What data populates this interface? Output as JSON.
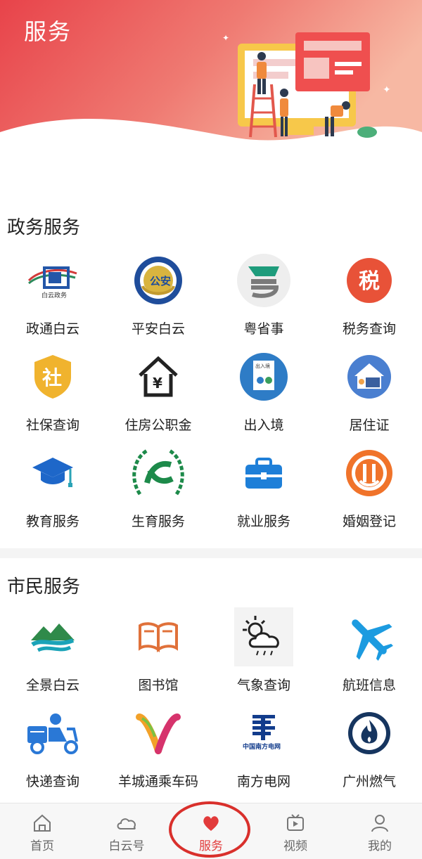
{
  "header": {
    "title": "服务"
  },
  "sections": [
    {
      "title": "政务服务",
      "items": [
        {
          "label": "政通白云",
          "icon": "baiyun-gov-icon"
        },
        {
          "label": "平安白云",
          "icon": "police-badge-icon"
        },
        {
          "label": "粤省事",
          "icon": "yueshengshi-icon"
        },
        {
          "label": "税务查询",
          "icon": "tax-icon"
        },
        {
          "label": "社保查询",
          "icon": "social-security-icon"
        },
        {
          "label": "住房公职金",
          "icon": "housing-fund-icon"
        },
        {
          "label": "出入境",
          "icon": "immigration-icon"
        },
        {
          "label": "居住证",
          "icon": "residence-permit-icon"
        },
        {
          "label": "教育服务",
          "icon": "graduation-cap-icon"
        },
        {
          "label": "生育服务",
          "icon": "birth-service-icon"
        },
        {
          "label": "就业服务",
          "icon": "briefcase-icon"
        },
        {
          "label": "婚姻登记",
          "icon": "marriage-registration-icon"
        }
      ]
    },
    {
      "title": "市民服务",
      "items": [
        {
          "label": "全景白云",
          "icon": "mountain-panorama-icon"
        },
        {
          "label": "图书馆",
          "icon": "book-icon"
        },
        {
          "label": "气象查询",
          "icon": "weather-icon"
        },
        {
          "label": "航班信息",
          "icon": "airplane-icon"
        },
        {
          "label": "快递查询",
          "icon": "delivery-scooter-icon"
        },
        {
          "label": "羊城通乘车码",
          "icon": "yangchengtong-icon"
        },
        {
          "label": "南方电网",
          "icon": "power-grid-icon"
        },
        {
          "label": "广州燃气",
          "icon": "gas-flame-icon"
        }
      ]
    }
  ],
  "icon_text": {
    "baiyun_gov": "白云政务",
    "police": "公安",
    "tax": "税",
    "social": "社",
    "housing": "¥",
    "immigration": "出入境",
    "grid_cn": "中国南方电网"
  },
  "tabs": [
    {
      "label": "首页",
      "icon": "home-icon",
      "active": false
    },
    {
      "label": "白云号",
      "icon": "cloud-icon",
      "active": false
    },
    {
      "label": "服务",
      "icon": "heart-icon",
      "active": true
    },
    {
      "label": "视频",
      "icon": "video-icon",
      "active": false
    },
    {
      "label": "我的",
      "icon": "user-icon",
      "active": false
    }
  ],
  "colors": {
    "brand_red": "#e23b3b",
    "header_gradient_start": "#e8474a",
    "header_gradient_end": "#f6b79a"
  }
}
